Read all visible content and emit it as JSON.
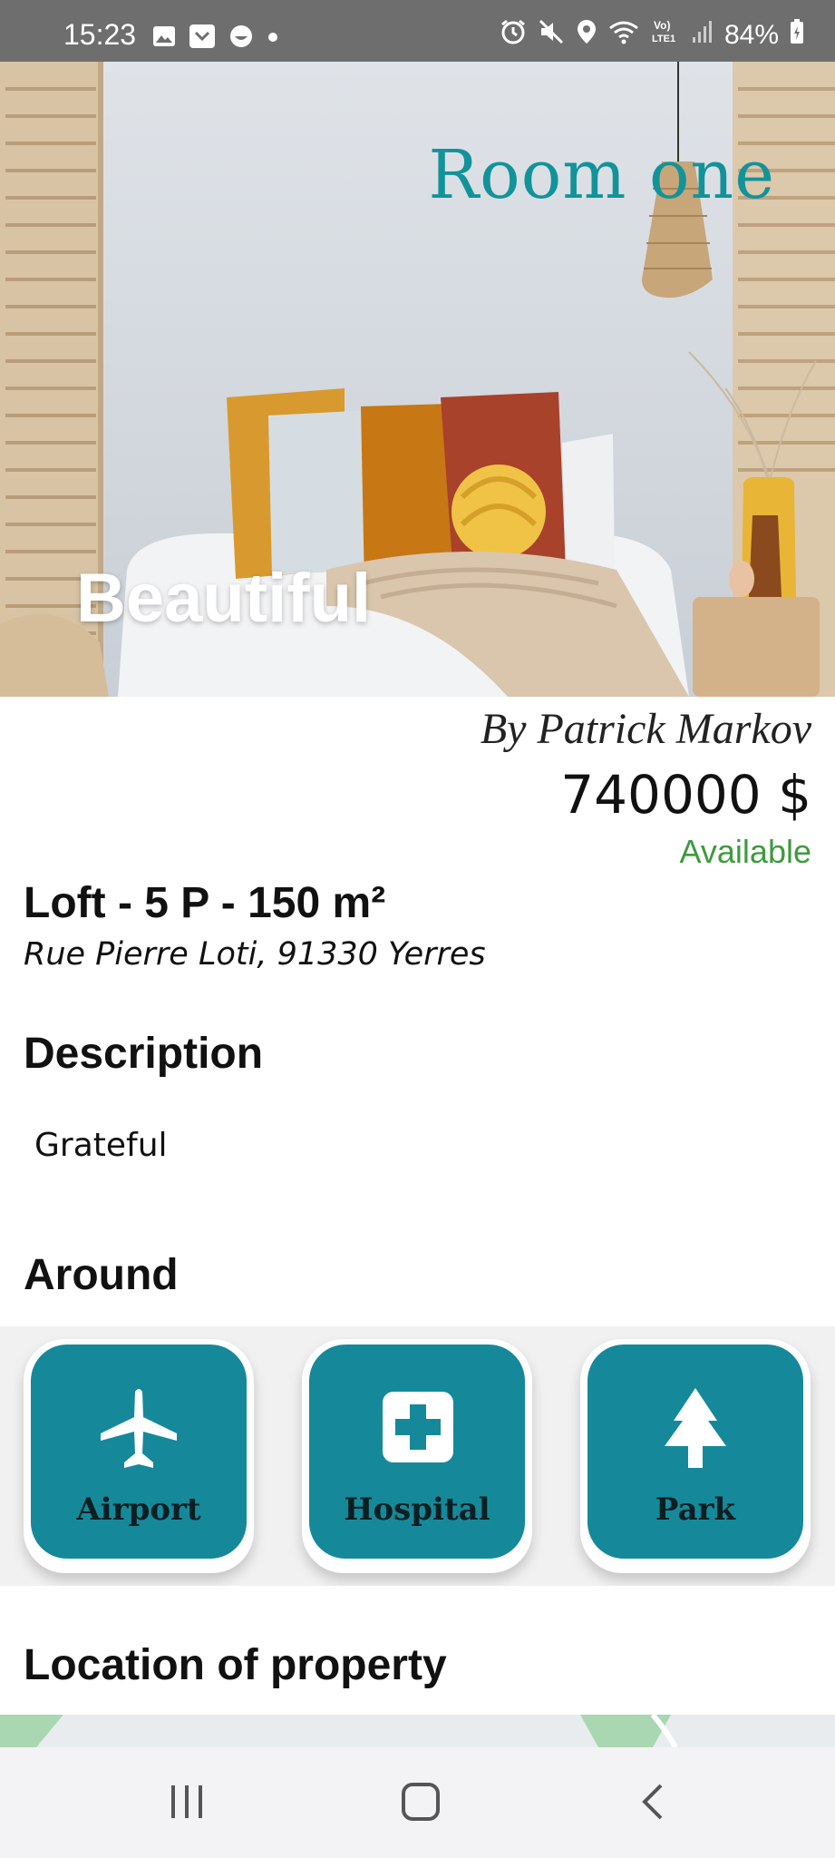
{
  "status_bar": {
    "time": "15:23",
    "battery": "84%",
    "left_icons": [
      "gallery-icon",
      "pocket-icon",
      "emoji-icon",
      "dot-icon"
    ],
    "right_icons": [
      "alarm-icon",
      "mute-icon",
      "location-icon",
      "wifi-icon",
      "volte-icon",
      "signal-icon",
      "battery-icon"
    ],
    "volte_label": "Vo)\nLTE1"
  },
  "hero": {
    "title": "Room one",
    "caption": "Beautiful",
    "title_color": "#12939a"
  },
  "listing": {
    "owner": "By Patrick Markov",
    "price": "740000 $",
    "availability": "Available",
    "availability_color": "#3e9a3e",
    "type": "Loft - 5 P - 150 m²",
    "address": "Rue Pierre Loti, 91330 Yerres"
  },
  "description": {
    "heading": "Description",
    "text": "Grateful"
  },
  "around": {
    "heading": "Around",
    "accent": "#15899a",
    "items": [
      {
        "label": "Airport",
        "icon": "airplane-icon"
      },
      {
        "label": "Hospital",
        "icon": "hospital-cross-icon"
      },
      {
        "label": "Park",
        "icon": "tree-icon"
      }
    ]
  },
  "location": {
    "heading": "Location of property"
  },
  "nav_bar": {
    "buttons": [
      "recent-apps-icon",
      "home-icon",
      "back-icon"
    ]
  }
}
